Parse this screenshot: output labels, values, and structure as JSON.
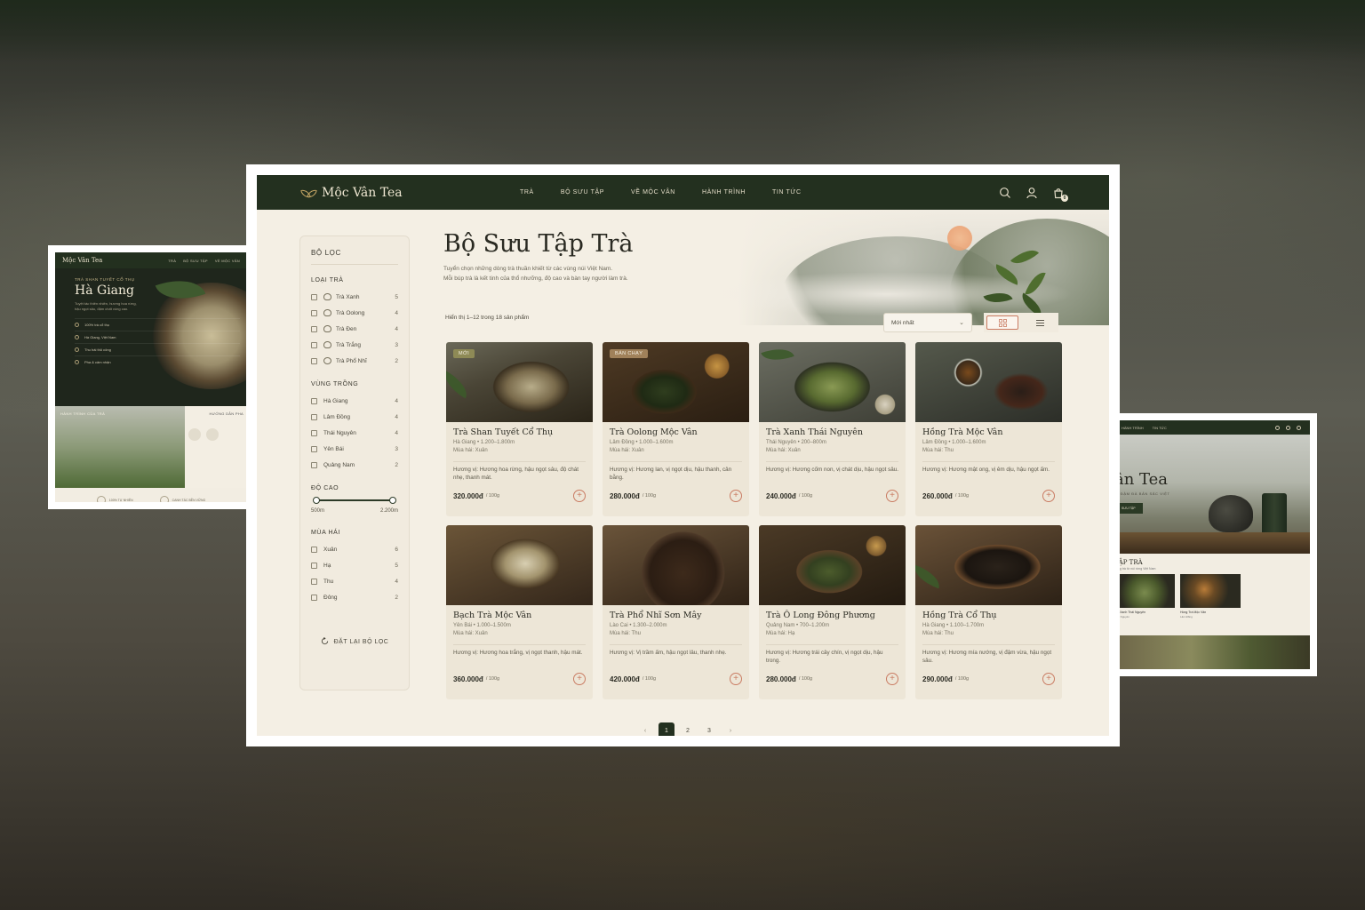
{
  "left_preview": {
    "brand": "Mộc Vân Tea",
    "nav": [
      "TRÀ",
      "BỘ SƯU TẬP",
      "VỀ MỘC VÂN"
    ],
    "kicker": "TRÀ SHAN TUYẾT CỔ THỤ",
    "title": "Hà Giang",
    "desc": "Tuyệt tác thiên nhiên, hương hoa rừng, hậu ngọt sâu, đậm chất vùng cao.",
    "features": [
      "100% trà cổ thụ",
      "Hà Giang, Việt Nam",
      "Thu hái thủ công",
      "Pha & cảm nhận"
    ],
    "journey_title": "HÀNH TRÌNH CỦA TRÀ",
    "guide_title": "HƯỚNG DẪN PHA",
    "footer": [
      "100% TỰ NHIÊN",
      "CANH TÁC BỀN VỮNG"
    ]
  },
  "right_preview": {
    "nav": [
      "HÀNH TRÌNH",
      "TIN TỨC"
    ],
    "title": "ân Tea",
    "subtitle": "N, ĐẬM ĐÀ BẢN SẮC VIỆT",
    "button": "SƯU TẬP",
    "collection_title": "TẬP TRÀ",
    "collection_sub": "dòng trà từ núi rừng Việt Nam",
    "cards": [
      {
        "name": "Trà Xanh Thái Nguyên",
        "price": "Thái Nguyên"
      },
      {
        "name": "Hồng Trà Mộc Vân",
        "price": "Lâm Đồng"
      }
    ]
  },
  "navbar": {
    "brand": "Mộc Vân Tea",
    "menu": [
      "TRÀ",
      "BỘ SƯU TẬP",
      "VỀ MỘC VÂN",
      "HÀNH TRÌNH",
      "TIN TỨC"
    ],
    "cart_count": "0"
  },
  "hero": {
    "title": "Bộ Sưu Tập Trà",
    "desc_line1": "Tuyển chọn những dòng trà thuần khiết từ các vùng núi Việt Nam.",
    "desc_line2": "Mỗi búp trà là kết tinh của thổ nhưỡng, độ cao và bàn tay người làm trà."
  },
  "filters": {
    "title": "BỘ LỌC",
    "tea_type_title": "LOẠI TRÀ",
    "tea_types": [
      {
        "label": "Trà Xanh",
        "count": "5"
      },
      {
        "label": "Trà Oolong",
        "count": "4"
      },
      {
        "label": "Trà Đen",
        "count": "4"
      },
      {
        "label": "Trà Trắng",
        "count": "3"
      },
      {
        "label": "Trà Phổ Nhĩ",
        "count": "2"
      }
    ],
    "region_title": "VÙNG TRỒNG",
    "regions": [
      {
        "label": "Hà Giang",
        "count": "4"
      },
      {
        "label": "Lâm Đồng",
        "count": "4"
      },
      {
        "label": "Thái Nguyên",
        "count": "4"
      },
      {
        "label": "Yên Bái",
        "count": "3"
      },
      {
        "label": "Quảng Nam",
        "count": "2"
      }
    ],
    "altitude_title": "ĐỘ CAO",
    "altitude_min": "500m",
    "altitude_max": "2.200m",
    "season_title": "MÙA HÁI",
    "seasons": [
      {
        "label": "Xuân",
        "count": "6"
      },
      {
        "label": "Hạ",
        "count": "5"
      },
      {
        "label": "Thu",
        "count": "4"
      },
      {
        "label": "Đông",
        "count": "2"
      }
    ],
    "reset": "ĐẶT LẠI BỘ LỌC"
  },
  "toolbar": {
    "result_count": "Hiển thị 1–12 trong 18 sản phẩm",
    "sort": "Mới nhất"
  },
  "products": [
    {
      "badge": "MỚI",
      "name": "Trà Shan Tuyết Cổ Thụ",
      "meta": "Hà Giang • 1.200–1.800m",
      "season": "Mùa hái: Xuân",
      "flavor": "Hương vị: Hương hoa rừng, hậu ngọt sâu, độ chát nhẹ, thanh mát.",
      "price": "320.000đ",
      "unit": "/ 100g"
    },
    {
      "badge": "BÁN CHẠY",
      "name": "Trà Oolong Mộc Vân",
      "meta": "Lâm Đồng • 1.000–1.600m",
      "season": "Mùa hái: Xuân",
      "flavor": "Hương vị: Hương lan, vị ngọt dịu, hậu thanh, cân bằng.",
      "price": "280.000đ",
      "unit": "/ 100g"
    },
    {
      "badge": "",
      "name": "Trà Xanh Thái Nguyên",
      "meta": "Thái Nguyên • 200–800m",
      "season": "Mùa hái: Xuân",
      "flavor": "Hương vị: Hương cốm non, vị chát dịu, hậu ngọt sâu.",
      "price": "240.000đ",
      "unit": "/ 100g"
    },
    {
      "badge": "",
      "name": "Hồng Trà Mộc Vân",
      "meta": "Lâm Đồng • 1.000–1.600m",
      "season": "Mùa hái: Thu",
      "flavor": "Hương vị: Hương mật ong, vị êm dịu, hậu ngọt ấm.",
      "price": "260.000đ",
      "unit": "/ 100g"
    },
    {
      "badge": "",
      "name": "Bạch Trà Mộc Vân",
      "meta": "Yên Bái • 1.000–1.500m",
      "season": "Mùa hái: Xuân",
      "flavor": "Hương vị: Hương hoa trắng, vị ngọt thanh, hậu mát.",
      "price": "360.000đ",
      "unit": "/ 100g"
    },
    {
      "badge": "",
      "name": "Trà Phổ Nhĩ Sơn Mây",
      "meta": "Lào Cai • 1.300–2.000m",
      "season": "Mùa hái: Thu",
      "flavor": "Hương vị: Vị trầm ấm, hậu ngọt lâu, thanh nhẹ.",
      "price": "420.000đ",
      "unit": "/ 100g"
    },
    {
      "badge": "",
      "name": "Trà Ô Long Đông Phương",
      "meta": "Quảng Nam • 700–1.200m",
      "season": "Mùa hái: Hạ",
      "flavor": "Hương vị: Hương trái cây chín, vị ngọt dịu, hậu trong.",
      "price": "280.000đ",
      "unit": "/ 100g"
    },
    {
      "badge": "",
      "name": "Hồng Trà Cổ Thụ",
      "meta": "Hà Giang • 1.100–1.700m",
      "season": "Mùa hái: Thu",
      "flavor": "Hương vị: Hương mía nướng, vị đậm vừa, hậu ngọt sâu.",
      "price": "290.000đ",
      "unit": "/ 100g"
    }
  ],
  "pagination": {
    "prev": "‹",
    "pages": [
      "1",
      "2",
      "3"
    ],
    "active": "1",
    "next": "›"
  }
}
